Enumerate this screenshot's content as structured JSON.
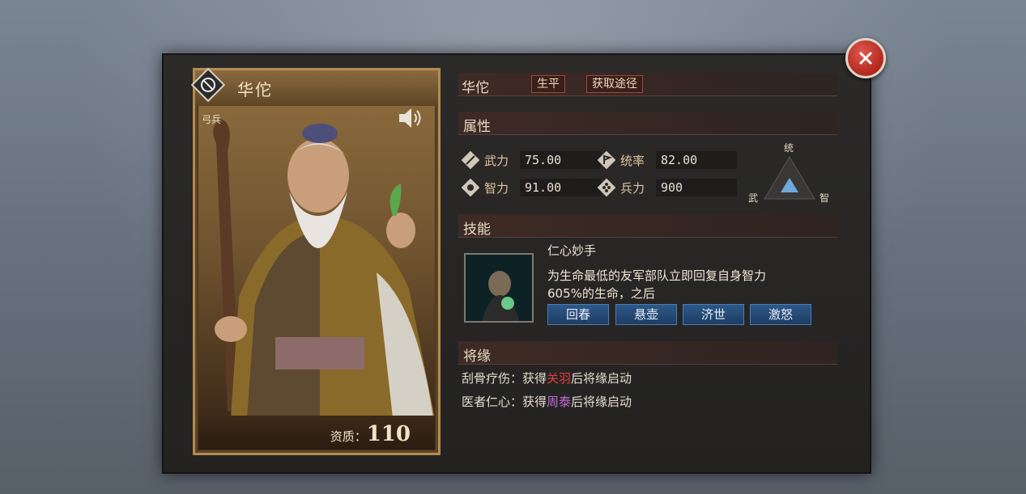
{
  "card": {
    "name": "华佗",
    "troop_type": "弓兵",
    "quality_label": "资质：",
    "quality_value": "110",
    "icons": {
      "emblem": "general-emblem-icon",
      "speaker": "speaker-icon"
    }
  },
  "header": {
    "name": "华佗",
    "biography_button": "生平",
    "obtain_button": "获取途径"
  },
  "attributes": {
    "title": "属性",
    "stats": [
      {
        "label": "武力",
        "value": "75.00",
        "icon": "sword-icon"
      },
      {
        "label": "统率",
        "value": "82.00",
        "icon": "flag-icon"
      },
      {
        "label": "智力",
        "value": "91.00",
        "icon": "hand-icon"
      },
      {
        "label": "兵力",
        "value": "900",
        "icon": "troops-icon"
      }
    ],
    "radar": {
      "top": "统",
      "left": "武",
      "right": "智"
    }
  },
  "skills": {
    "title": "技能",
    "name": "仁心妙手",
    "description": "为生命最低的友军部队立即回复自身智力605%的生命，之后",
    "buttons": [
      "回春",
      "悬壶",
      "济世",
      "激怒"
    ]
  },
  "fate": {
    "title": "将缘",
    "lines": [
      {
        "prefix": "刮骨疗伤：获得",
        "hero": "关羽",
        "suffix": "后将缘启动"
      },
      {
        "prefix": "医者仁心：获得",
        "hero": "周泰",
        "suffix": "后将缘启动"
      }
    ]
  },
  "close_icon": "close-icon",
  "colors": {
    "accent_red": "#e23e3e",
    "accent_purple": "#c46ad8",
    "skill_button_blue": "#2d5888"
  }
}
